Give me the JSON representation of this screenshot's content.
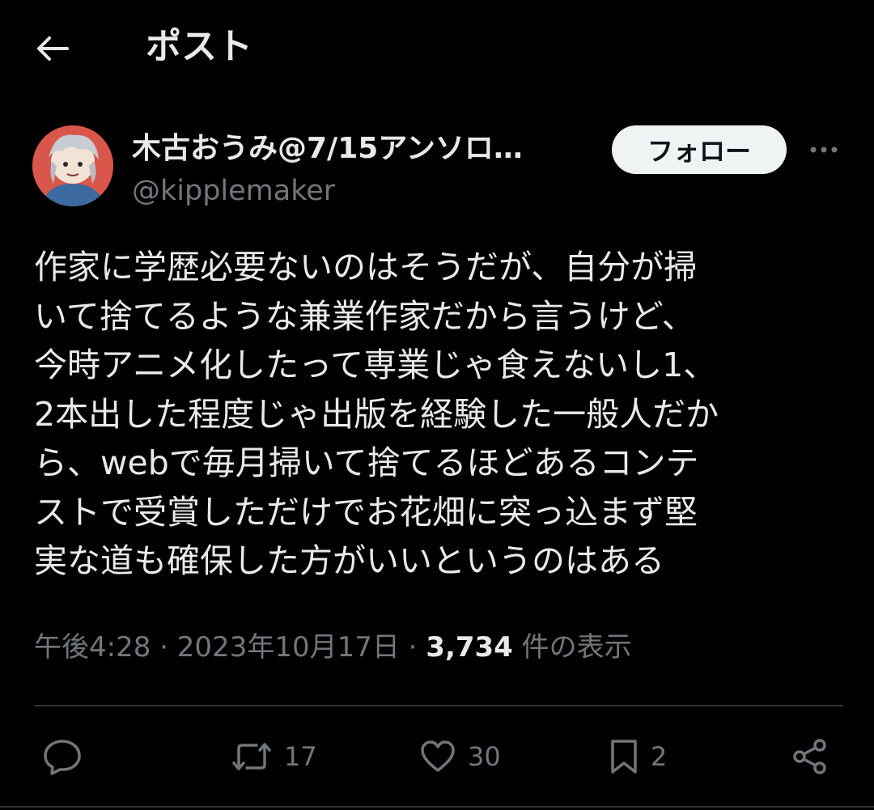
{
  "header": {
    "title": "ポスト"
  },
  "author": {
    "display_name": "木古おうみ@7/15アンソロ…",
    "handle": "@kipplemaker",
    "follow_label": "フォロー"
  },
  "tweet": {
    "lines": [
      "作家に学歴必要ないのはそうだが、自分が掃",
      "いて捨てるような兼業作家だから言うけど、",
      "今時アニメ化したって専業じゃ食えないし1、",
      "2本出した程度じゃ出版を経験した一般人だか",
      "ら、webで毎月掃いて捨てるほどあるコンテ",
      "ストで受賞しただけでお花畑に突っ込まず堅",
      "実な道も確保した方がいいというのはある"
    ]
  },
  "meta": {
    "time": "午後4:28",
    "separator": "·",
    "date": "2023年10月17日",
    "views_count": "3,734",
    "views_label": "件の表示"
  },
  "actions": {
    "reply_icon": "reply-icon",
    "retweet_count": "17",
    "like_count": "30",
    "bookmark_count": "2",
    "share_icon": "share-icon"
  },
  "colors": {
    "background": "#000000",
    "text_primary": "#e7e9ea",
    "text_secondary": "#71767b",
    "follow_bg": "#eff3f4",
    "divider": "#2f3336"
  }
}
